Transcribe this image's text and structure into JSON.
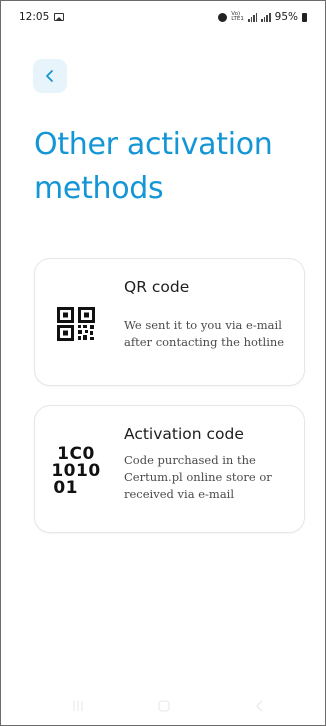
{
  "status_bar": {
    "time": "12:05",
    "battery_percent": "95%",
    "network_label_top": "Vo)",
    "network_label_bottom": "LTE1"
  },
  "header": {
    "back_icon": "chevron-left-icon",
    "title": "Other activation methods"
  },
  "methods": [
    {
      "icon": "qr-code-icon",
      "title": "QR code",
      "description": "We sent it to you via e-mail after contacting the hotline"
    },
    {
      "icon": "binary-code-icon",
      "icon_text_lines": [
        "1C0",
        "1010",
        "01"
      ],
      "title": "Activation code",
      "description": "Code purchased in the Certum.pl online store or received via e-mail"
    }
  ],
  "nav_bar": {
    "icons": [
      "recent-apps-icon",
      "home-icon",
      "back-icon"
    ]
  },
  "colors": {
    "accent": "#1496d6",
    "back_button_bg": "#e7f4fb",
    "card_border": "#e6e6e6"
  }
}
